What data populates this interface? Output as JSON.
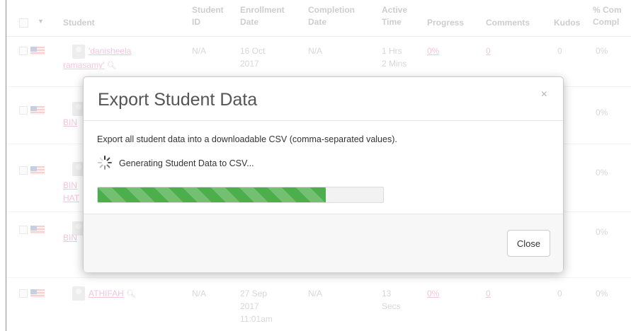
{
  "table": {
    "headers": {
      "student": "Student",
      "student_id": [
        "Student",
        "ID"
      ],
      "enrollment_date": [
        "Enrollment",
        "Date"
      ],
      "completion_date": [
        "Completion",
        "Date"
      ],
      "active_time": [
        "Active",
        "Time"
      ],
      "progress": "Progress",
      "comments": "Comments",
      "kudos": "Kudos",
      "completion": [
        "% Com",
        "Compl"
      ]
    },
    "rows": [
      {
        "name": "'danisheela",
        "name2": "ramasamy'",
        "id": "N/A",
        "enroll": [
          "16 Oct",
          "2017"
        ],
        "complete": "N/A",
        "time": [
          "1 Hrs",
          "2 Mins"
        ],
        "progress": "0%",
        "comments": "0",
        "kudos": "0",
        "pct": "0%"
      },
      {
        "name": "BIN",
        "pct": "0%"
      },
      {
        "name": "BIN",
        "name2": "HAT",
        "pct": "0%"
      },
      {
        "name": "BIN",
        "pct": "0%"
      },
      {
        "name": "ATHIFAH",
        "id": "N/A",
        "enroll": [
          "27 Sep",
          "2017",
          "11:01am"
        ],
        "complete": "N/A",
        "time": [
          "13",
          "Secs"
        ],
        "progress": "0%",
        "comments": "0",
        "kudos": "0",
        "pct": "0%"
      }
    ]
  },
  "modal": {
    "title": "Export Student Data",
    "close_symbol": "×",
    "description": "Export all student data into a downloadable CSV (comma-separated values).",
    "status_text": "Generating Student Data to CSV...",
    "progress_fraction": 0.8,
    "progress_color": "#4cae4c",
    "close_button_label": "Close",
    "spinner_icon": "loading-spinner-icon"
  }
}
